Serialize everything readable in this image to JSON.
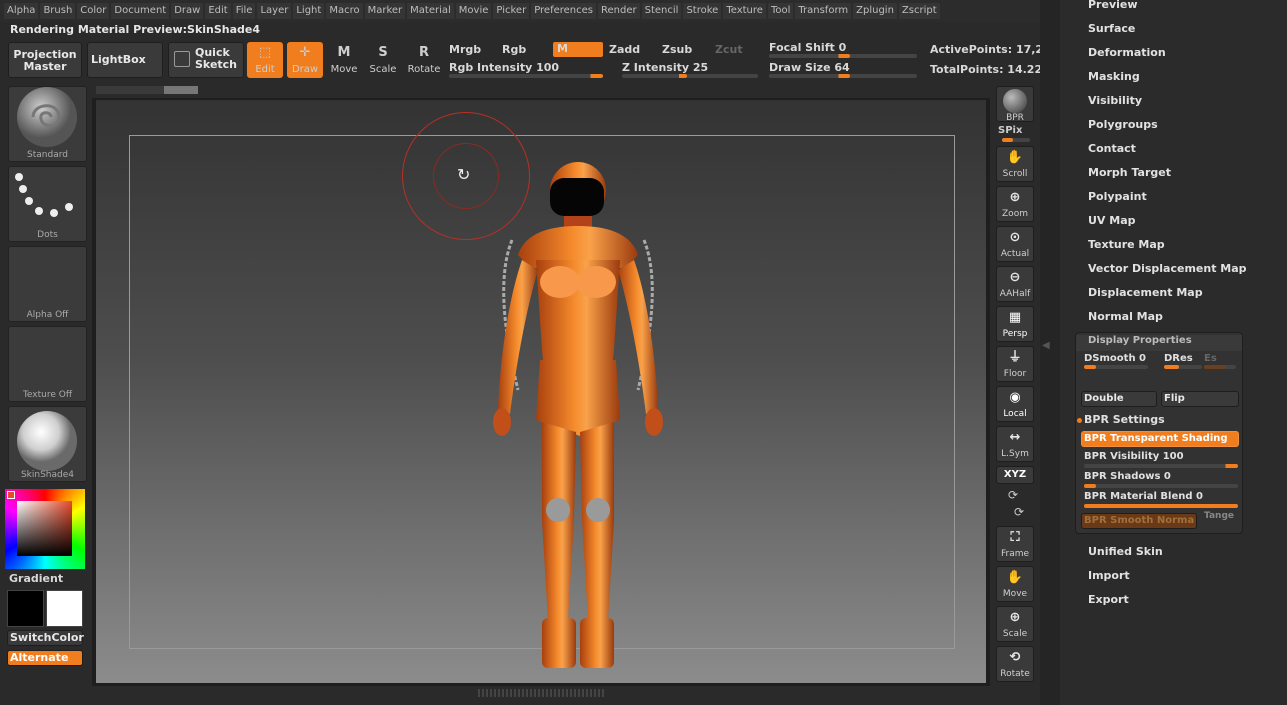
{
  "menu": [
    "Alpha",
    "Brush",
    "Color",
    "Document",
    "Draw",
    "Edit",
    "File",
    "Layer",
    "Light",
    "Macro",
    "Marker",
    "Material",
    "Movie",
    "Picker",
    "Preferences",
    "Render",
    "Stencil",
    "Stroke",
    "Texture",
    "Tool",
    "Transform",
    "Zplugin",
    "Zscript"
  ],
  "status_text": "Rendering Material Preview:SkinShade4",
  "toolbar": {
    "projection_master": "Projection Master",
    "lightbox": "LightBox",
    "quick_sketch": "Quick Sketch",
    "edit": "Edit",
    "draw": "Draw",
    "move": "Move",
    "scale": "Scale",
    "rotate": "Rotate",
    "mrgb": "Mrgb",
    "rgb": "Rgb",
    "m": "M",
    "zadd": "Zadd",
    "zsub": "Zsub",
    "zcut": "Zcut",
    "rgb_intensity": "Rgb Intensity 100",
    "z_intensity": "Z Intensity 25",
    "focal_shift": "Focal Shift 0",
    "draw_size": "Draw Size 64",
    "active_points": "ActivePoints: 17,2",
    "total_points": "TotalPoints: 14.22"
  },
  "left_shelf": {
    "brush": "Standard",
    "stroke": "Dots",
    "alpha": "Alpha  Off",
    "texture": "Texture  Off",
    "material": "SkinShade4",
    "gradient": "Gradient",
    "switch_color": "SwitchColor",
    "alternate": "Alternate",
    "main_color": "#e74a2c"
  },
  "right_shelf": {
    "bpr": "BPR",
    "spix": "SPix",
    "scroll": "Scroll",
    "zoom": "Zoom",
    "actual": "Actual",
    "aahalf": "AAHalf",
    "persp": "Persp",
    "floor": "Floor",
    "local": "Local",
    "lsym": "L.Sym",
    "xyz": "XYZ",
    "frame": "Frame",
    "move": "Move",
    "scale": "Scale",
    "rotate": "Rotate"
  },
  "palette": {
    "items_top": [
      "Preview",
      "Surface",
      "Deformation",
      "Masking",
      "Visibility",
      "Polygroups",
      "Contact",
      "Morph Target",
      "Polypaint",
      "UV Map",
      "Texture Map",
      "Vector Displacement Map",
      "Displacement Map",
      "Normal Map"
    ],
    "display_properties": {
      "title": "Display Properties",
      "dsmooth": "DSmooth 0",
      "dres": "DRes",
      "es": "Es",
      "double": "Double",
      "flip": "Flip",
      "bpr_settings": "BPR Settings",
      "bpr_transparent": "BPR Transparent Shading",
      "bpr_visibility": "BPR Visibility 100",
      "bpr_visibility_value": 1.0,
      "bpr_shadows": "BPR Shadows 0",
      "bpr_material_blend": "BPR Material Blend 0",
      "bpr_smooth_normals": "BPR Smooth Norma",
      "tange": "Tange"
    },
    "items_bottom": [
      "Unified Skin",
      "Import",
      "Export"
    ]
  },
  "colors": {
    "accent": "#f07e1e",
    "background": "#2a2a2a",
    "brush_cursor": "#c0302a"
  }
}
